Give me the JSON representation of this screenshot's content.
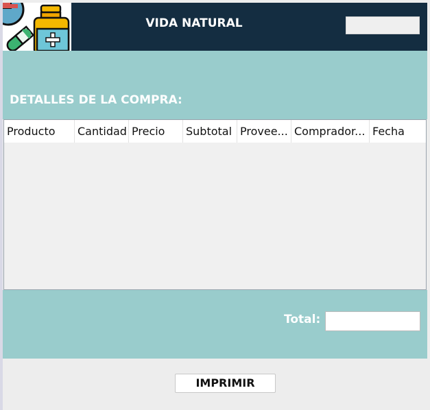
{
  "header": {
    "title": "VIDA NATURAL",
    "field_value": ""
  },
  "section": {
    "title": "DETALLES DE LA COMPRA:"
  },
  "table": {
    "columns": [
      "Producto",
      "Cantidad",
      "Precio",
      "Subtotal",
      "Provee...",
      "Comprador...",
      "Fecha"
    ],
    "rows": []
  },
  "footer": {
    "total_label": "Total:",
    "total_value": "",
    "print_label": "IMPRIMIR"
  }
}
